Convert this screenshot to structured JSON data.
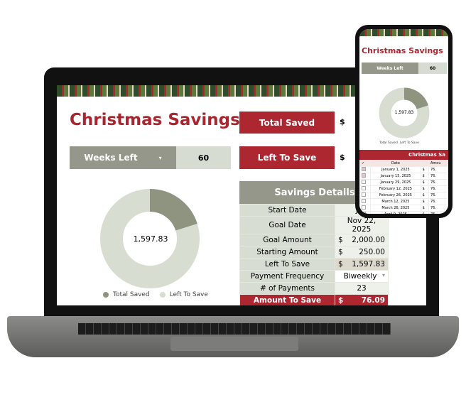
{
  "sheet": {
    "title": "Christmas Savings",
    "weeks_left": {
      "label": "Weeks Left",
      "value": "60"
    },
    "total_saved": {
      "label": "Total Saved",
      "currency": "$"
    },
    "left_to_save": {
      "label": "Left To Save",
      "currency": "$"
    },
    "chart": {
      "center_value": "1,597.83",
      "total_saved_fraction": 0.201,
      "legend": [
        "Total Saved",
        "Left To Save"
      ],
      "colors": {
        "total_saved": "#8f9480",
        "left_to_save": "#d8ddd1"
      }
    },
    "details": {
      "header": "Savings Details",
      "rows": [
        {
          "label": "Start Date",
          "currency": "",
          "value": "Jan"
        },
        {
          "label": "Goal Date",
          "currency": "",
          "value": "Nov 22, 2025"
        },
        {
          "label": "Goal Amount",
          "currency": "$",
          "value": "2,000.00"
        },
        {
          "label": "Starting Amount",
          "currency": "$",
          "value": "250.00"
        },
        {
          "label": "Left To Save",
          "currency": "$",
          "value": "1,597.83"
        },
        {
          "label": "Payment Frequency",
          "currency": "",
          "value": "Biweekly"
        },
        {
          "label": "# of Payments",
          "currency": "",
          "value": "23"
        }
      ],
      "total": {
        "label": "Amount To Save",
        "currency": "$",
        "value": "76.09"
      }
    }
  },
  "phone": {
    "title": "Christmas Savings",
    "weeks_label": "Weeks Left",
    "weeks_value": "60",
    "center_value": "1,597.83",
    "legend": [
      "Total Saved",
      "Left To Save"
    ],
    "table_header": "Christmas Sa",
    "col_check": "✓",
    "col_date": "Date",
    "col_amount": "Amou",
    "rows": [
      {
        "date": "January 1, 2025",
        "checked": true,
        "cur": "$",
        "amt": "76."
      },
      {
        "date": "January 15, 2025",
        "checked": true,
        "cur": "$",
        "amt": "76."
      },
      {
        "date": "January 29, 2025",
        "checked": false,
        "cur": "$",
        "amt": "76."
      },
      {
        "date": "February 12, 2025",
        "checked": false,
        "cur": "$",
        "amt": "76."
      },
      {
        "date": "February 26, 2025",
        "checked": false,
        "cur": "$",
        "amt": "76."
      },
      {
        "date": "March 12, 2025",
        "checked": false,
        "cur": "$",
        "amt": "76."
      },
      {
        "date": "March 26, 2025",
        "checked": false,
        "cur": "$",
        "amt": "76."
      },
      {
        "date": "April 9, 2025",
        "checked": false,
        "cur": "$",
        "amt": "76."
      }
    ]
  }
}
